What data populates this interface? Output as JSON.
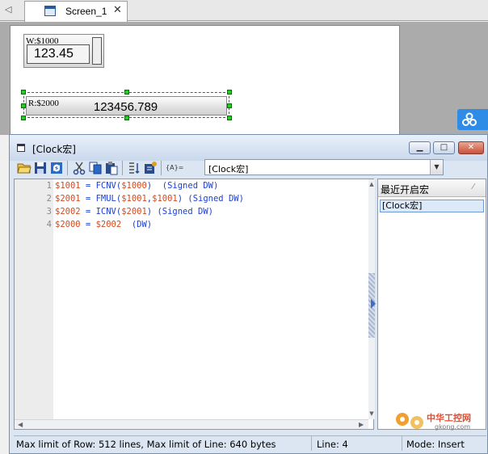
{
  "tabs": {
    "active_label": "Screen_1",
    "close_glyph": "✕",
    "nav_glyph": "◁"
  },
  "canvas": {
    "word_display": {
      "label": "W:$1000",
      "value": "123.45"
    },
    "read_display": {
      "label": "R:$2000",
      "value": "123456.789"
    }
  },
  "macro_window": {
    "title": "[Clock宏]",
    "selected_macro": "[Clock宏]",
    "select_arrow": "▼",
    "toolbar_label_macro": "{A}="
  },
  "code_lines": [
    {
      "number": "1",
      "tokens": [
        {
          "t": "$1001",
          "c": "var"
        },
        {
          "t": " = ",
          "c": "kw"
        },
        {
          "t": "FCNV(",
          "c": "kw"
        },
        {
          "t": "$1000",
          "c": "var"
        },
        {
          "t": ")  (Signed DW)",
          "c": "kw"
        }
      ]
    },
    {
      "number": "2",
      "tokens": [
        {
          "t": "$2001",
          "c": "var"
        },
        {
          "t": " = ",
          "c": "kw"
        },
        {
          "t": "FMUL(",
          "c": "kw"
        },
        {
          "t": "$1001",
          "c": "var"
        },
        {
          "t": ",",
          "c": "kw"
        },
        {
          "t": "$1001",
          "c": "var"
        },
        {
          "t": ") (Signed DW)",
          "c": "kw"
        }
      ]
    },
    {
      "number": "3",
      "tokens": [
        {
          "t": "$2002",
          "c": "var"
        },
        {
          "t": " = ",
          "c": "kw"
        },
        {
          "t": "ICNV(",
          "c": "kw"
        },
        {
          "t": "$2001",
          "c": "var"
        },
        {
          "t": ") (Signed DW)",
          "c": "kw"
        }
      ]
    },
    {
      "number": "4",
      "tokens": [
        {
          "t": "$2000",
          "c": "var"
        },
        {
          "t": " = ",
          "c": "kw"
        },
        {
          "t": "$2002",
          "c": "var"
        },
        {
          "t": "  (DW)",
          "c": "kw"
        }
      ]
    }
  ],
  "recent_panel": {
    "header": "最近开启宏",
    "items": [
      "[Clock宏]"
    ]
  },
  "status": {
    "limits": "Max limit of Row: 512 lines, Max limit of Line: 640 bytes",
    "line": "Line: 4",
    "mode": "Mode: Insert"
  },
  "watermark": {
    "text": "中华工控网",
    "site": "gkong.com"
  },
  "colors": {
    "variable": "#d04a20",
    "keyword": "#1d3fd0",
    "selection_handle": "#1fd11f",
    "float_button": "#2f8ce6"
  },
  "icons": {
    "toolbar": [
      "open-folder-icon",
      "save-icon",
      "refresh-icon",
      "cut-icon",
      "copy-icon",
      "paste-icon",
      "sort-icon",
      "compile-icon",
      "macro-variable-icon"
    ]
  }
}
